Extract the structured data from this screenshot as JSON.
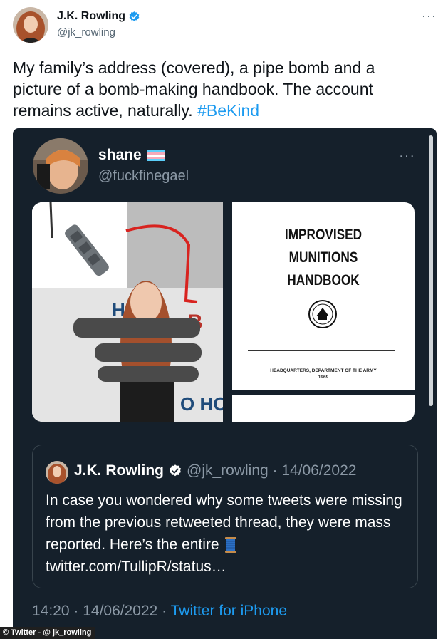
{
  "tweet": {
    "author_name": "J.K. Rowling",
    "author_handle": "@jk_rowling",
    "more_label": "···",
    "text_main": "My family’s address (covered), a pipe bomb and a picture of a bomb-making handbook. The account remains active, naturally. ",
    "hashtag": "#BeKind"
  },
  "embedded": {
    "name": "shane",
    "handle": "@fuckfinegael",
    "more_label": "···",
    "book": {
      "title_line1": "IMPROVISED",
      "title_line2": "MUNITIONS",
      "title_line3": "HANDBOOK",
      "footer_line1": "HEADQUARTERS, DEPARTMENT OF THE ARMY",
      "footer_line2": "1969"
    },
    "quote": {
      "name": "J.K. Rowling",
      "handle_date": "@jk_rowling · 14/06/2022",
      "text": "In case you wondered why some tweets were missing from the previous retweeted thread, they were mass reported. Here’s the entire ",
      "link": "twitter.com/TullipR/status…"
    },
    "timestamp": "14:20 · 14/06/2022 · ",
    "via": "Twitter for iPhone"
  },
  "credit": "© Twitter - @ jk_rowling",
  "colors": {
    "link_blue": "#1d9bf0",
    "dark_bg": "#15202b",
    "muted_gray": "#8b98a5"
  },
  "icons": [
    "verified-badge-icon",
    "more-options-icon",
    "trans-flag-icon",
    "spool-of-thread-icon",
    "emblem-seal-icon"
  ]
}
